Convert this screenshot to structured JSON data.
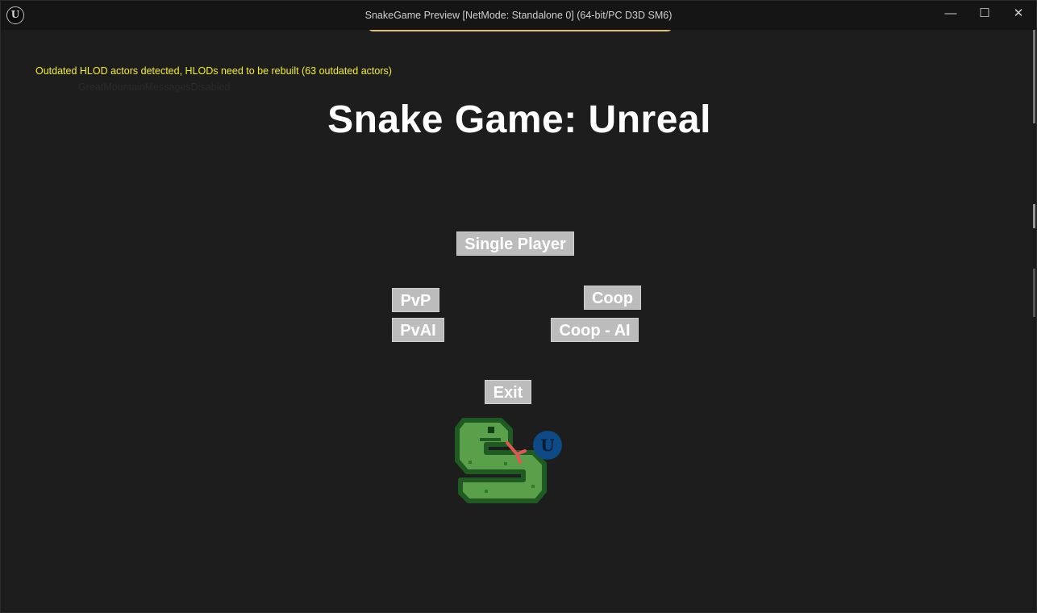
{
  "window": {
    "title": "SnakeGame Preview [NetMode: Standalone 0]  (64-bit/PC D3D SM6)",
    "app_icon": "unreal-engine-logo-icon",
    "controls": {
      "minimize": "—",
      "maximize": "☐",
      "close": "✕"
    }
  },
  "hud": {
    "warning": "Outdated HLOD actors detected, HLODs need to be rebuilt (63 outdated actors)",
    "faded_text": "GreatMountainMessagesDisabled"
  },
  "menu": {
    "title": "Snake Game: Unreal",
    "single_player": "Single Player",
    "pvp": "PvP",
    "coop": "Coop",
    "pvai": "PvAI",
    "coop_ai": "Coop - AI",
    "exit": "Exit"
  },
  "colors": {
    "warning": "#f2ef24",
    "button_bg": "#bcbcbc",
    "snake_green": "#5aa04a",
    "snake_outline": "#1f5a23",
    "tongue": "#e05656",
    "ue_badge": "#0e4a86"
  }
}
